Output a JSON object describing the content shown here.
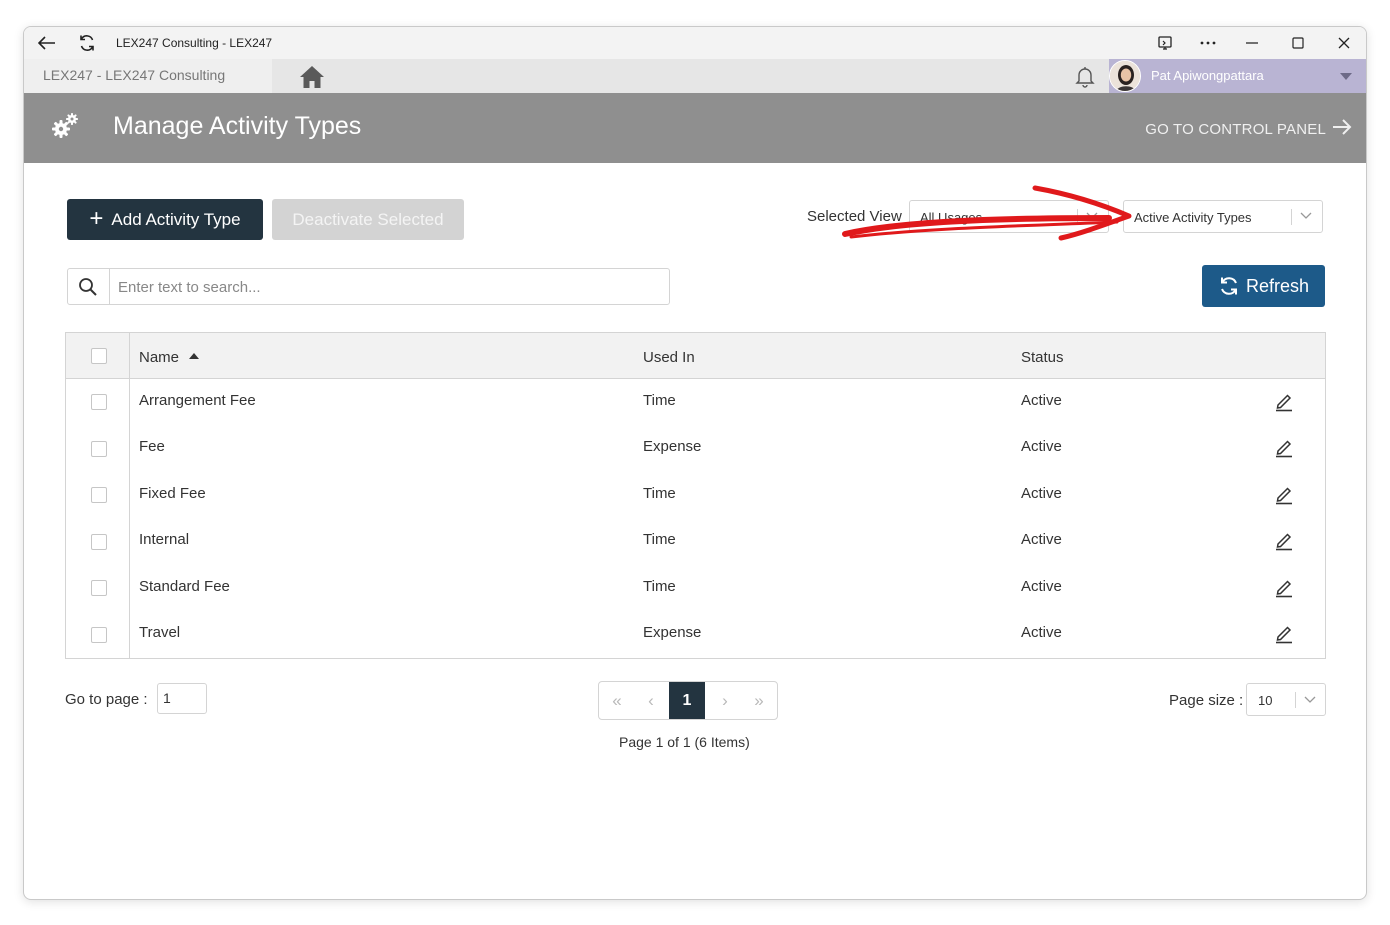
{
  "window": {
    "title": "LEX247 Consulting - LEX247"
  },
  "appbar": {
    "org": "LEX247  -  LEX247 Consulting",
    "user_name": "Pat Apiwongpattara"
  },
  "header": {
    "title": "Manage Activity Types",
    "control_panel_link": "GO TO CONTROL PANEL"
  },
  "toolbar": {
    "add_label": "Add Activity Type",
    "deactivate_label": "Deactivate Selected",
    "selected_view_label": "Selected View",
    "usage_filter_value": "All Usages",
    "status_filter_value": "Active Activity Types"
  },
  "search": {
    "placeholder": "Enter text to search..."
  },
  "refresh_label": "Refresh",
  "grid": {
    "columns": [
      "Name",
      "Used In",
      "Status"
    ],
    "rows": [
      {
        "name": "Arrangement Fee",
        "used_in": "Time",
        "status": "Active"
      },
      {
        "name": "Fee",
        "used_in": "Expense",
        "status": "Active"
      },
      {
        "name": "Fixed Fee",
        "used_in": "Time",
        "status": "Active"
      },
      {
        "name": "Internal",
        "used_in": "Time",
        "status": "Active"
      },
      {
        "name": "Standard Fee",
        "used_in": "Time",
        "status": "Active"
      },
      {
        "name": "Travel",
        "used_in": "Expense",
        "status": "Active"
      }
    ]
  },
  "pager": {
    "goto_label": "Go to page :",
    "goto_value": "1",
    "current_page": "1",
    "info": "Page 1 of 1 (6 Items)",
    "page_size_label": "Page size :",
    "page_size": "10"
  },
  "colors": {
    "header_bg": "#8f8f8f",
    "primary_dark": "#233440",
    "refresh_blue": "#1d5a89",
    "user_tab": "#b9b4d3",
    "annotation_red": "#e0191b"
  }
}
